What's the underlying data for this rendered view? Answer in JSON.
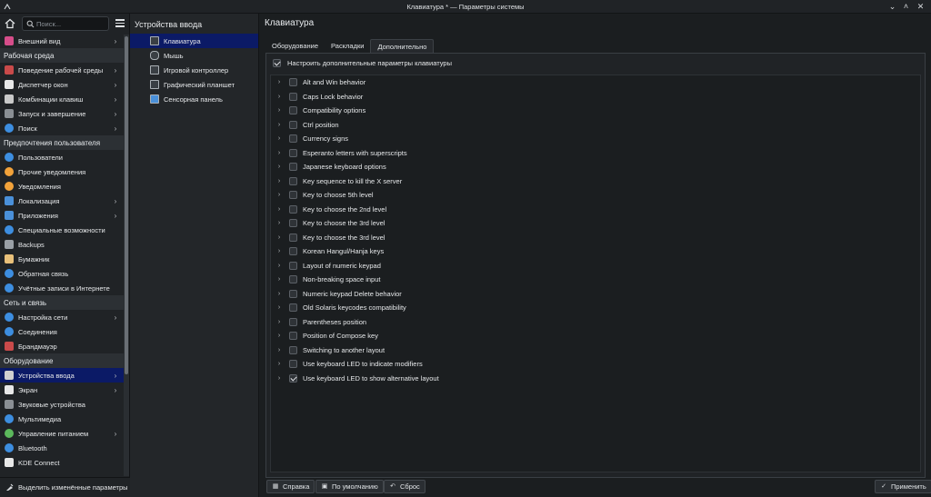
{
  "window": {
    "title": "Клавиатура * — Параметры системы"
  },
  "search": {
    "placeholder": "Поиск..."
  },
  "sidebar": {
    "items": [
      {
        "type": "item",
        "label": "Внешний вид",
        "icon": "appearance-icon",
        "color": "#d64d8a",
        "chevron": true
      },
      {
        "type": "category",
        "label": "Рабочая среда"
      },
      {
        "type": "item",
        "label": "Поведение рабочей среды",
        "icon": "workspace-behavior-icon",
        "color": "#c94a4a",
        "chevron": true
      },
      {
        "type": "item",
        "label": "Диспетчер окон",
        "icon": "window-manager-icon",
        "color": "#e8e8e8",
        "chevron": true
      },
      {
        "type": "item",
        "label": "Комбинации клавиш",
        "icon": "shortcuts-icon",
        "color": "#c9c9c9",
        "chevron": true
      },
      {
        "type": "item",
        "label": "Запуск и завершение",
        "icon": "startup-icon",
        "color": "#8a8f94",
        "chevron": true
      },
      {
        "type": "item",
        "label": "Поиск",
        "icon": "search-icon",
        "color": "#3d8ee0",
        "chevron": true
      },
      {
        "type": "category",
        "label": "Предпочтения пользователя"
      },
      {
        "type": "item",
        "label": "Пользователи",
        "icon": "users-icon",
        "color": "#3d8ee0",
        "chevron": false
      },
      {
        "type": "item",
        "label": "Прочие уведомления",
        "icon": "bell-icon",
        "color": "#f2a23a",
        "chevron": false
      },
      {
        "type": "item",
        "label": "Уведомления",
        "icon": "bell-icon",
        "color": "#f2a23a",
        "chevron": false
      },
      {
        "type": "item",
        "label": "Локализация",
        "icon": "locale-icon",
        "color": "#4a90d9",
        "chevron": true
      },
      {
        "type": "item",
        "label": "Приложения",
        "icon": "applications-icon",
        "color": "#4a90d9",
        "chevron": true
      },
      {
        "type": "item",
        "label": "Специальные возможности",
        "icon": "accessibility-icon",
        "color": "#3d8ee0",
        "chevron": false
      },
      {
        "type": "item",
        "label": "Backups",
        "icon": "backup-icon",
        "color": "#9aa0a6",
        "chevron": false
      },
      {
        "type": "item",
        "label": "Бумажник",
        "icon": "wallet-icon",
        "color": "#e8c07a",
        "chevron": false
      },
      {
        "type": "item",
        "label": "Обратная связь",
        "icon": "feedback-icon",
        "color": "#3d8ee0",
        "chevron": false
      },
      {
        "type": "item",
        "label": "Учётные записи в Интернете",
        "icon": "online-accounts-icon",
        "color": "#3d8ee0",
        "chevron": false
      },
      {
        "type": "category",
        "label": "Сеть и связь"
      },
      {
        "type": "item",
        "label": "Настройка сети",
        "icon": "network-icon",
        "color": "#3d8ee0",
        "chevron": true
      },
      {
        "type": "item",
        "label": "Соединения",
        "icon": "connections-icon",
        "color": "#3d8ee0",
        "chevron": false
      },
      {
        "type": "item",
        "label": "Брандмауэр",
        "icon": "firewall-icon",
        "color": "#c94a4a",
        "chevron": false
      },
      {
        "type": "category",
        "label": "Оборудование"
      },
      {
        "type": "item",
        "label": "Устройства ввода",
        "icon": "input-devices-icon",
        "color": "#d0d0d0",
        "chevron": true,
        "selected": true
      },
      {
        "type": "item",
        "label": "Экран",
        "icon": "display-icon",
        "color": "#e8e8e8",
        "chevron": true
      },
      {
        "type": "item",
        "label": "Звуковые устройства",
        "icon": "audio-icon",
        "color": "#8a8f94",
        "chevron": false
      },
      {
        "type": "item",
        "label": "Мультимедиа",
        "icon": "multimedia-icon",
        "color": "#3d8ee0",
        "chevron": false
      },
      {
        "type": "item",
        "label": "Управление питанием",
        "icon": "power-icon",
        "color": "#5cb85c",
        "chevron": true
      },
      {
        "type": "item",
        "label": "Bluetooth",
        "icon": "bluetooth-icon",
        "color": "#3d8ee0",
        "chevron": false
      },
      {
        "type": "item",
        "label": "KDE Connect",
        "icon": "kde-connect-icon",
        "color": "#e8e8e8",
        "chevron": false
      }
    ],
    "bottom_label": "Выделить изменённые параметры"
  },
  "subpanel": {
    "title": "Устройства ввода",
    "items": [
      {
        "label": "Клавиатура",
        "icon": "keyboard-icon",
        "selected": true
      },
      {
        "label": "Мышь",
        "icon": "mouse-icon",
        "selected": false
      },
      {
        "label": "Игровой контроллер",
        "icon": "gamepad-icon",
        "selected": false
      },
      {
        "label": "Графический планшет",
        "icon": "tablet-icon",
        "selected": false
      },
      {
        "label": "Сенсорная панель",
        "icon": "touchpad-icon",
        "selected": false
      }
    ]
  },
  "main": {
    "title": "Клавиатура",
    "tabs": [
      {
        "label": "Оборудование",
        "active": false
      },
      {
        "label": "Раскладки",
        "active": false
      },
      {
        "label": "Дополнительно",
        "active": true
      }
    ],
    "configure_label": "Настроить дополнительные параметры клавиатуры",
    "configure_checked": true,
    "options": [
      {
        "label": "Alt and Win behavior",
        "checked": false
      },
      {
        "label": "Caps Lock behavior",
        "checked": false
      },
      {
        "label": "Compatibility options",
        "checked": false
      },
      {
        "label": "Ctrl position",
        "checked": false
      },
      {
        "label": "Currency signs",
        "checked": false
      },
      {
        "label": "Esperanto letters with superscripts",
        "checked": false
      },
      {
        "label": "Japanese keyboard options",
        "checked": false
      },
      {
        "label": "Key sequence to kill the X server",
        "checked": false
      },
      {
        "label": "Key to choose 5th level",
        "checked": false
      },
      {
        "label": "Key to choose the 2nd level",
        "checked": false
      },
      {
        "label": "Key to choose the 3rd level",
        "checked": false
      },
      {
        "label": "Key to choose the 3rd level",
        "checked": false
      },
      {
        "label": "Korean Hangul/Hanja keys",
        "checked": false
      },
      {
        "label": "Layout of numeric keypad",
        "checked": false
      },
      {
        "label": "Non-breaking space input",
        "checked": false
      },
      {
        "label": "Numeric keypad Delete behavior",
        "checked": false
      },
      {
        "label": "Old Solaris keycodes compatibility",
        "checked": false
      },
      {
        "label": "Parentheses position",
        "checked": false
      },
      {
        "label": "Position of Compose key",
        "checked": false
      },
      {
        "label": "Switching to another layout",
        "checked": false
      },
      {
        "label": "Use keyboard LED to indicate modifiers",
        "checked": false
      },
      {
        "label": "Use keyboard LED to show alternative layout",
        "checked": true
      }
    ],
    "buttons": {
      "help": "Справка",
      "defaults": "По умолчанию",
      "reset": "Сброс",
      "apply": "Применить"
    }
  }
}
